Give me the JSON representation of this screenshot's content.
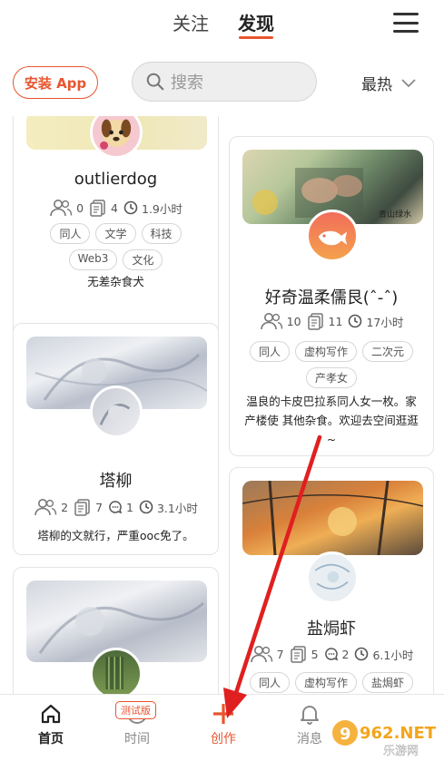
{
  "header": {
    "tabs": [
      "关注",
      "发现"
    ],
    "active_tab": "发现"
  },
  "toolbar": {
    "install_label": "安装 App",
    "search_placeholder": "搜索",
    "sort_label": "最热"
  },
  "cards": [
    {
      "name": "outlierdog",
      "followers": "0",
      "posts": "4",
      "updated": "1.9小时",
      "tags": [
        "同人",
        "文学",
        "科技",
        "Web3",
        "文化"
      ],
      "desc": "无差杂食犬"
    },
    {
      "name": "好奇温柔儒艮(ˆ-ˆ)",
      "followers": "10",
      "posts": "11",
      "updated": "17小时",
      "tags": [
        "同人",
        "虚构写作",
        "二次元",
        "产孝女"
      ],
      "desc": "温良的卡皮巴拉系同人女一枚。家产楼使 其他杂食。欢迎去空间逛逛 ~"
    },
    {
      "name": "塔柳",
      "followers": "2",
      "posts": "7",
      "comments": "1",
      "updated": "3.1小时",
      "desc": "塔柳的文就行，严重ooc免了。"
    },
    {
      "name": "盐焗虾",
      "followers": "7",
      "posts": "5",
      "comments": "2",
      "updated": "6.1小时",
      "tags": [
        "同人",
        "虚构写作",
        "盐焗虾"
      ]
    }
  ],
  "bottom_nav": {
    "items": [
      "首页",
      "时间",
      "创作",
      "消息"
    ],
    "active": "首页",
    "beta_badge": "测试版"
  },
  "watermark": {
    "text": "962.NET",
    "sub": "乐游网"
  },
  "colors": {
    "accent": "#e8552f",
    "arrow": "#e02020"
  }
}
